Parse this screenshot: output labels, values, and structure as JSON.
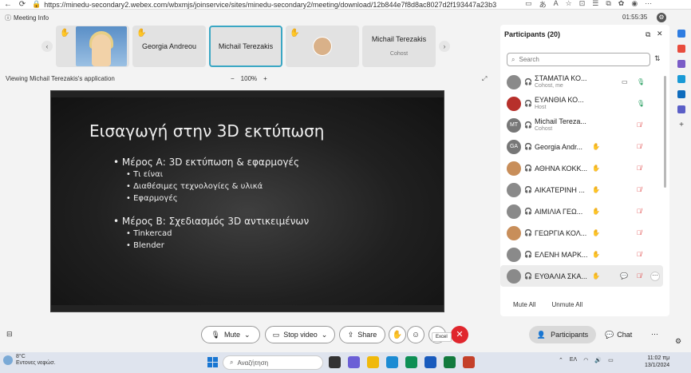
{
  "browser": {
    "url": "https://minedu-secondary2.webex.com/wbxmjs/joinservice/sites/minedu-secondary2/meeting/download/12b844e7f8d8ac8027d2f193447a23b3"
  },
  "header": {
    "meeting_info": "Meeting Info",
    "timer": "01:55:35"
  },
  "thumbnails": [
    {
      "name": "Georgia Andreou",
      "sub": ""
    },
    {
      "name": "Michail Terezakis",
      "sub": ""
    },
    {
      "name": "Michail Terezakis",
      "sub": "Cohost"
    }
  ],
  "viewing": {
    "label": "Viewing Michail Terezakis's application",
    "zoom_minus": "−",
    "zoom": "100%",
    "zoom_plus": "+"
  },
  "slide": {
    "title": "Εισαγωγή στην 3D εκτύπωση",
    "sections": [
      {
        "heading": "• Μέρος Α: 3D εκτύπωση & εφαρμογές",
        "items": [
          "• Τι είναι",
          "• Διαθέσιμες τεχνολογίες & υλικά",
          "• Εφαρμογές"
        ]
      },
      {
        "heading": "• Μέρος Β: Σχεδιασμός 3D αντικειμένων",
        "items": [
          "• Tinkercad",
          "• Blender"
        ]
      }
    ]
  },
  "participants": {
    "title": "Participants (20)",
    "search_placeholder": "Search",
    "list": [
      {
        "name": "ΣΤΑΜΑΤΙΑ ΚΟ...",
        "role": "Cohost, me",
        "avatar": "",
        "mic": "on",
        "cam": true
      },
      {
        "name": "ΕΥΑΝΘΙΑ ΚΟ...",
        "role": "Host",
        "avatar": "",
        "mic": "on",
        "cam": false
      },
      {
        "name": "Michail Tereza...",
        "role": "Cohost",
        "avatar": "MT",
        "mic": "off",
        "cam": false
      },
      {
        "name": "Georgia Andr...",
        "role": "",
        "avatar": "GA",
        "mic": "off",
        "cam": false
      },
      {
        "name": "ΑΘΗΝΑ ΚΟΚΚ...",
        "role": "",
        "avatar": "",
        "mic": "off",
        "cam": false
      },
      {
        "name": "ΑΙΚΑΤΕΡΙΝΗ ...",
        "role": "",
        "avatar": "",
        "mic": "off",
        "cam": false
      },
      {
        "name": "ΑΙΜΙΛΙΑ ΓΕΩ...",
        "role": "",
        "avatar": "",
        "mic": "off",
        "cam": false
      },
      {
        "name": "ΓΕΩΡΓΙΑ ΚΟΛ...",
        "role": "",
        "avatar": "",
        "mic": "off",
        "cam": false
      },
      {
        "name": "ΕΛΕΝΗ ΜΑΡΚ...",
        "role": "",
        "avatar": "",
        "mic": "off",
        "cam": false
      },
      {
        "name": "ΕΥΘΑΛΙΑ ΣΚΑ...",
        "role": "",
        "avatar": "",
        "mic": "off",
        "cam": false
      }
    ],
    "mute_all": "Mute All",
    "unmute_all": "Unmute All"
  },
  "controls": {
    "mute": "Mute",
    "stop_video": "Stop video",
    "share": "Share",
    "tooltip": "Excel",
    "participants": "Participants",
    "chat": "Chat"
  },
  "taskbar": {
    "temp": "8°C",
    "weather": "Εντονες νεφώσ.",
    "search": "Αναζήτηση",
    "lang": "ΕΛ",
    "time": "11:02 πμ",
    "date": "13/1/2024"
  }
}
